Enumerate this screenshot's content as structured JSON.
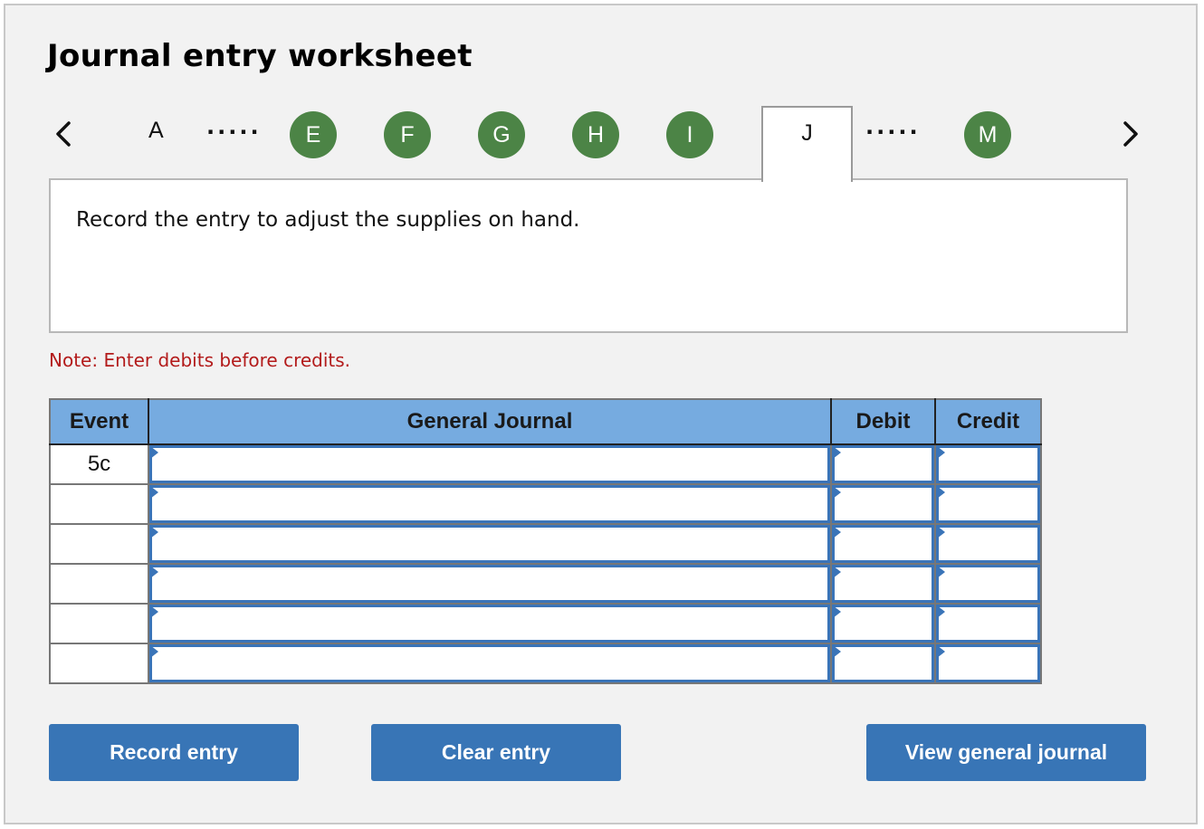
{
  "header": {
    "title": "Journal entry worksheet"
  },
  "navigator": {
    "prev_icon": "chevron-left-icon",
    "next_icon": "chevron-right-icon",
    "ellipsis": ".....",
    "steps": [
      {
        "label": "A",
        "state": "unvisited"
      },
      {
        "label": "E",
        "state": "completed"
      },
      {
        "label": "F",
        "state": "completed"
      },
      {
        "label": "G",
        "state": "completed"
      },
      {
        "label": "H",
        "state": "completed"
      },
      {
        "label": "I",
        "state": "completed"
      },
      {
        "label": "J",
        "state": "active"
      },
      {
        "label": "M",
        "state": "completed"
      }
    ],
    "completed_color": "#4c8446"
  },
  "instruction": {
    "text": "Record the entry to adjust the supplies on hand."
  },
  "note": {
    "text": "Note: Enter debits before credits.",
    "color": "#b31b1b"
  },
  "journal": {
    "header_color": "#76abe0",
    "input_border_color": "#3a74b8",
    "columns": [
      "Event",
      "General Journal",
      "Debit",
      "Credit"
    ],
    "rows": [
      {
        "event": "5c",
        "account": "",
        "debit": "",
        "credit": ""
      },
      {
        "event": "",
        "account": "",
        "debit": "",
        "credit": ""
      },
      {
        "event": "",
        "account": "",
        "debit": "",
        "credit": ""
      },
      {
        "event": "",
        "account": "",
        "debit": "",
        "credit": ""
      },
      {
        "event": "",
        "account": "",
        "debit": "",
        "credit": ""
      },
      {
        "event": "",
        "account": "",
        "debit": "",
        "credit": ""
      }
    ]
  },
  "actions": {
    "button_color": "#3875b6",
    "record_label": "Record entry",
    "clear_label": "Clear entry",
    "view_label": "View general journal"
  }
}
